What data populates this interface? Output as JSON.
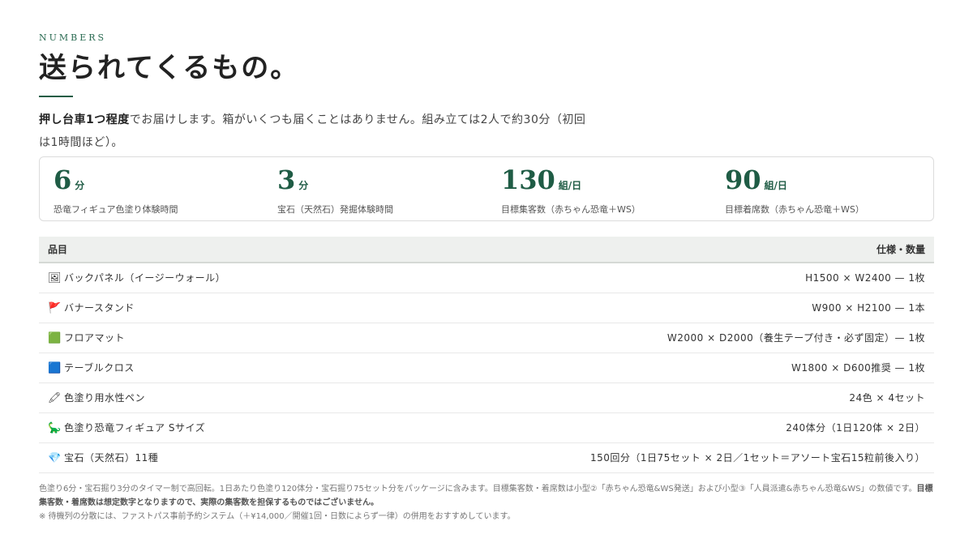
{
  "header": {
    "eyebrow": "NUMBERS",
    "title": "送られてくるもの。"
  },
  "intro": {
    "bold": "押し台車1つ程度",
    "text1": "でお届けします。箱がいくつも届くことはありません。組み立ては2人で約30分（初回",
    "text2": "は1時間ほど）。"
  },
  "stats": [
    {
      "value": "6",
      "unit": "分",
      "label": "恐竜フィギュア色塗り体験時間"
    },
    {
      "value": "3",
      "unit": "分",
      "label": "宝石（天然石）発掘体験時間"
    },
    {
      "value": "130",
      "unit": "組/日",
      "label": "目標集客数（赤ちゃん恐竜＋WS）"
    },
    {
      "value": "90",
      "unit": "組/日",
      "label": "目標着席数（赤ちゃん恐竜＋WS）"
    }
  ],
  "table": {
    "col_item": "品目",
    "col_spec": "仕様・数量",
    "rows": [
      {
        "icon": "🖼",
        "icon_name": "picture-frame-icon",
        "item": "バックパネル（イージーウォール）",
        "spec": "H1500 × W2400 — 1枚"
      },
      {
        "icon": "🚩",
        "icon_name": "red-flag-icon",
        "item": "バナースタンド",
        "spec": "W900 × H2100 — 1本"
      },
      {
        "icon": "🟩",
        "icon_name": "green-square-icon",
        "item": "フロアマット",
        "spec": "W2000 × D2000（養生テープ付き・必ず固定）— 1枚"
      },
      {
        "icon": "🟦",
        "icon_name": "blue-square-icon",
        "item": "テーブルクロス",
        "spec": "W1800 × D600推奨 — 1枚"
      },
      {
        "icon": "🖍",
        "icon_name": "crayon-icon",
        "item": "色塗り用水性ペン",
        "spec": "24色 × 4セット"
      },
      {
        "icon": "🦕",
        "icon_name": "dinosaur-icon",
        "item": "色塗り恐竜フィギュア Sサイズ",
        "spec": "240体分（1日120体 × 2日）"
      },
      {
        "icon": "💎",
        "icon_name": "gem-icon",
        "item": "宝石（天然石）11種",
        "spec": "150回分（1日75セット × 2日／1セット＝アソート宝石15粒前後入り）"
      }
    ]
  },
  "notes": {
    "line1": "色塗り6分・宝石掘り3分のタイマー制で高回転。1日あたり色塗り120体分・宝石掘り75セット分をパッケージに含みます。目標集客数・着席数は小型②「赤ちゃん恐竜&WS発送」および小型③「人員派遣&赤ちゃん恐竜&WS」の数値です。",
    "line1_bold": "目標集客数・着席数は想定数字となりますので、実際の集客数を担保するものではございません。",
    "line2": "※ 待機列の分散には、ファストパス事前予約システム（＋¥14,000／開催1回・日数によらず一律）の併用をおすすめしています。"
  },
  "colors": {
    "accent": "#1f5c45",
    "header_bg": "#eef0ee"
  }
}
